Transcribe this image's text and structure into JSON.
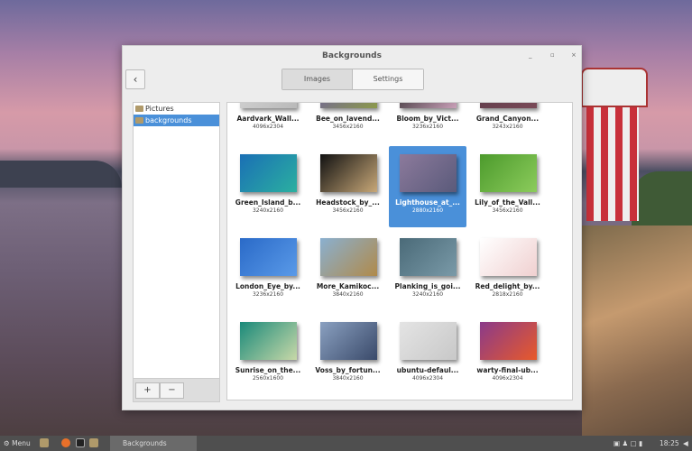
{
  "window": {
    "title": "Backgrounds",
    "minimize": "_",
    "maximize": "▫",
    "close": "×",
    "back": "‹",
    "tabs": [
      {
        "label": "Images",
        "active": true
      },
      {
        "label": "Settings",
        "active": false
      }
    ]
  },
  "sidebar": {
    "items": [
      {
        "label": "Pictures",
        "selected": false
      },
      {
        "label": "backgrounds",
        "selected": true
      }
    ],
    "add": "+",
    "remove": "−"
  },
  "images": [
    {
      "name": "Aardvark_Wall...",
      "size": "4096x2304",
      "colors": [
        "#d8d8d8",
        "#b9b9b9"
      ]
    },
    {
      "name": "Bee_on_lavend...",
      "size": "3456x2160",
      "colors": [
        "#6b5aa8",
        "#8c9a4a"
      ]
    },
    {
      "name": "Bloom_by_Vict...",
      "size": "3236x2160",
      "colors": [
        "#222",
        "#c9a0b8"
      ]
    },
    {
      "name": "Grand_Canyon...",
      "size": "3243x2160",
      "colors": [
        "#5a3a48",
        "#7a4a58"
      ]
    },
    {
      "name": "Green_Island_b...",
      "size": "3240x2160",
      "colors": [
        "#1a6fb5",
        "#2bb0a0"
      ]
    },
    {
      "name": "Headstock_by_...",
      "size": "3456x2160",
      "colors": [
        "#111",
        "#c8a878"
      ]
    },
    {
      "name": "Lighthouse_at_...",
      "size": "2880x2160",
      "colors": [
        "#8c7a9c",
        "#5a5a7a"
      ],
      "selected": true
    },
    {
      "name": "Lily_of_the_Vall...",
      "size": "3456x2160",
      "colors": [
        "#4c9a2c",
        "#8ccc5c"
      ]
    },
    {
      "name": "London_Eye_by...",
      "size": "3236x2160",
      "colors": [
        "#2a6ac8",
        "#5a9ae8"
      ]
    },
    {
      "name": "More_Kamikoc...",
      "size": "3840x2160",
      "colors": [
        "#8ab0d0",
        "#b08a4a"
      ]
    },
    {
      "name": "Planking_is_goi...",
      "size": "3240x2160",
      "colors": [
        "#4a6a78",
        "#7a9aa8"
      ]
    },
    {
      "name": "Red_delight_by...",
      "size": "2818x2160",
      "colors": [
        "#ffffff",
        "#f0d0d0"
      ]
    },
    {
      "name": "Sunrise_on_the...",
      "size": "2560x1600",
      "colors": [
        "#1a8a7a",
        "#c8d8a8"
      ]
    },
    {
      "name": "Voss_by_fortun...",
      "size": "3840x2160",
      "colors": [
        "#8aa0c0",
        "#3a4a6a"
      ]
    },
    {
      "name": "ubuntu-defaul...",
      "size": "4096x2304",
      "colors": [
        "#e4e4e4",
        "#c8c8c8"
      ]
    },
    {
      "name": "warty-final-ub...",
      "size": "4096x2304",
      "colors": [
        "#8a3a8a",
        "#e85a2a"
      ]
    }
  ],
  "taskbar": {
    "menu": "Menu",
    "window": "Backgrounds",
    "clock": "18:25"
  }
}
